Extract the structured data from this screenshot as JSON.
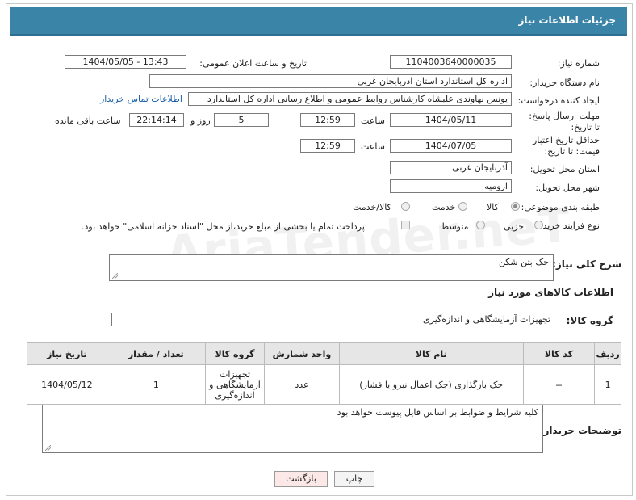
{
  "header": {
    "title": "جزئیات اطلاعات نیاز"
  },
  "fields": {
    "need_number_label": "شماره نیاز:",
    "need_number": "1104003640000035",
    "announce_label": "تاریخ و ساعت اعلان عمومی:",
    "announce_value": "1404/05/05 - 13:43",
    "buyer_org_label": "نام دستگاه خریدار:",
    "buyer_org": "اداره کل استاندارد استان اذربایجان غربی",
    "creator_label": "ایجاد کننده درخواست:",
    "creator": "یونس نهاوندی علیشاه کارشناس روابط عمومی و اطلاع رسانی اداره کل استاندارد",
    "contact_link": "اطلاعات تماس خریدار",
    "deadline_label": "مهلت ارسال پاسخ: تا تاریخ:",
    "deadline_date": "1404/05/11",
    "time_label": "ساعت",
    "deadline_time": "12:59",
    "days": "5",
    "days_label": "روز و",
    "remaining": "22:14:14",
    "remaining_label": "ساعت باقی مانده",
    "validity_label": "حداقل تاریخ اعتبار قیمت: تا تاریخ:",
    "validity_date": "1404/07/05",
    "validity_time": "12:59",
    "province_label": "استان محل تحویل:",
    "province": "آذربایجان غربی",
    "city_label": "شهر محل تحویل:",
    "city": "ارومیه",
    "category_label": "طبقه بندی موضوعی:",
    "category_options": [
      "کالا",
      "خدمت",
      "کالا/خدمت"
    ],
    "process_label": "نوع فرآیند خرید :",
    "process_options": [
      "جزیی",
      "متوسط"
    ],
    "payment_note": "پرداخت تمام یا بخشی از مبلغ خرید،از محل \"اسناد خزانه اسلامی\" خواهد بود."
  },
  "description": {
    "label": "شرح کلی نیاز:",
    "value": "جک بتن شکن"
  },
  "goods_section": {
    "title": "اطلاعات کالاهای مورد نیاز",
    "group_label": "گروه کالا:",
    "group_value": "تجهیزات آزمایشگاهی و اندازه‌گیری"
  },
  "table": {
    "headers": [
      "ردیف",
      "کد کالا",
      "نام کالا",
      "واحد شمارش",
      "گروه کالا",
      "تعداد / مقدار",
      "تاریخ نیاز"
    ],
    "rows": [
      {
        "row": "1",
        "code": "--",
        "name": "جک بارگذاری (جک اعمال نیرو یا فشار)",
        "unit": "عدد",
        "group": "تجهیزات آزمایشگاهی و اندازه‌گیری",
        "qty": "1",
        "date": "1404/05/12"
      }
    ]
  },
  "notes": {
    "label": "توضیحات خریدار:",
    "value": "کلیه شرایط و ضوابط بر اساس فایل پیوست خواهد بود"
  },
  "buttons": {
    "print": "چاپ",
    "back": "بازگشت"
  },
  "watermark": "AriaTender.neT",
  "colors": {
    "header": "#3a84a8",
    "link": "#1a5fa8",
    "back_button": "#fde8e8"
  }
}
